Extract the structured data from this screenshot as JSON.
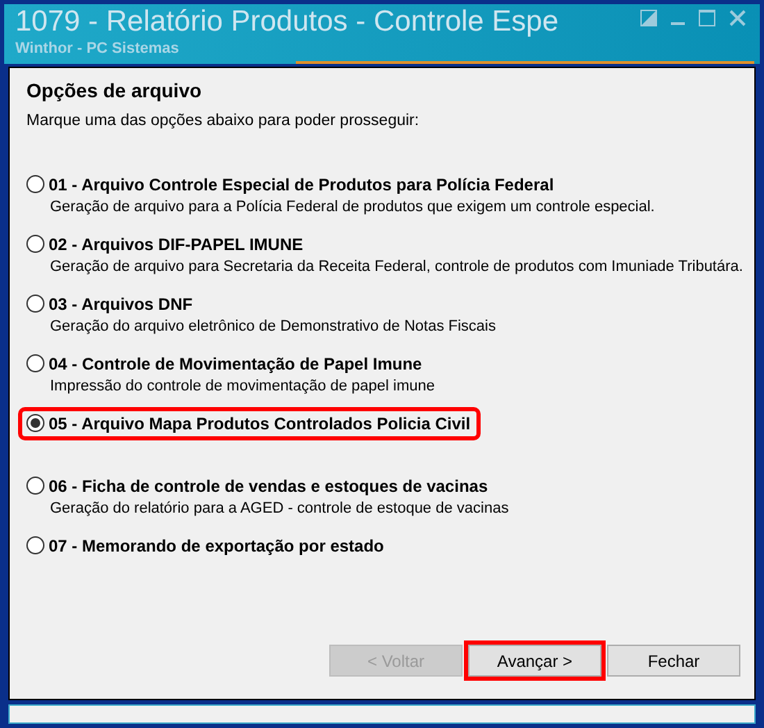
{
  "window": {
    "title": "1079 - Relatório Produtos - Controle Espe",
    "subtitle": "Winthor - PC Sistemas"
  },
  "section": {
    "title": "Opções de arquivo",
    "instruction": "Marque uma das opções abaixo para poder prosseguir:"
  },
  "options": [
    {
      "label": "01 - Arquivo Controle Especial de Produtos para Polícia Federal",
      "description": "Geração de arquivo para a Polícia Federal de produtos que exigem um controle especial.",
      "selected": false,
      "highlighted": false
    },
    {
      "label": "02 - Arquivos DIF-PAPEL IMUNE",
      "description": "Geração de arquivo para Secretaria da Receita Federal, controle de produtos com Imuniade Tributára.",
      "selected": false,
      "highlighted": false
    },
    {
      "label": "03 - Arquivos DNF",
      "description": "Geração do arquivo eletrônico de Demonstrativo de Notas Fiscais",
      "selected": false,
      "highlighted": false
    },
    {
      "label": "04 - Controle de Movimentação de Papel Imune",
      "description": "Impressão do controle de movimentação de papel imune",
      "selected": false,
      "highlighted": false
    },
    {
      "label": "05 - Arquivo Mapa Produtos Controlados Policia Civil",
      "selected": true,
      "highlighted": true
    },
    {
      "label": "06 - Ficha de controle de vendas e estoques de vacinas",
      "description": "Geração do relatório para a AGED - controle de estoque de vacinas",
      "selected": false,
      "highlighted": false
    },
    {
      "label": "07 - Memorando de exportação por estado",
      "selected": false,
      "highlighted": false
    }
  ],
  "buttons": [
    {
      "label": "< Voltar",
      "disabled": true,
      "highlighted": false
    },
    {
      "label": "Avançar >",
      "disabled": false,
      "highlighted": true
    },
    {
      "label": "Fechar",
      "disabled": false,
      "highlighted": false
    }
  ]
}
